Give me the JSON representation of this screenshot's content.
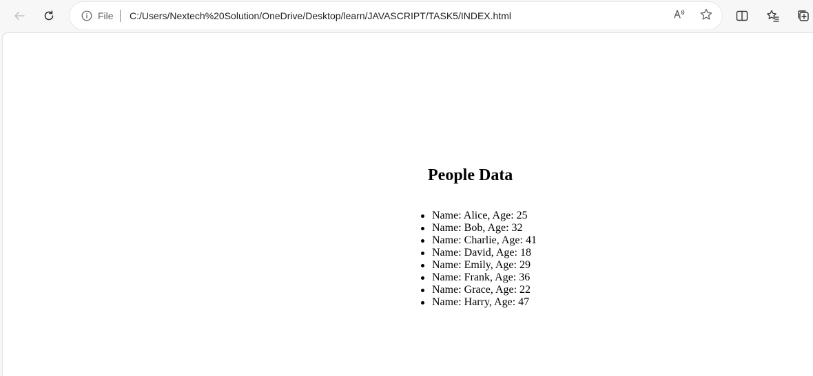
{
  "browser": {
    "address": {
      "scheme_label": "File",
      "url": "C:/Users/Nextech%20Solution/OneDrive/Desktop/learn/JAVASCRIPT/TASK5/INDEX.html"
    },
    "icons": {
      "back": "back-arrow-icon",
      "refresh": "refresh-icon",
      "info": "info-icon",
      "read_aloud": "read-aloud-icon",
      "favorite": "star-icon",
      "split_screen": "split-screen-icon",
      "favorites": "favorites-icon",
      "collections": "collections-icon"
    }
  },
  "page": {
    "heading": "People Data",
    "people": [
      "Name: Alice, Age: 25",
      "Name: Bob, Age: 32",
      "Name: Charlie, Age: 41",
      "Name: David, Age: 18",
      "Name: Emily, Age: 29",
      "Name: Frank, Age: 36",
      "Name: Grace, Age: 22",
      "Name: Harry, Age: 47"
    ]
  }
}
